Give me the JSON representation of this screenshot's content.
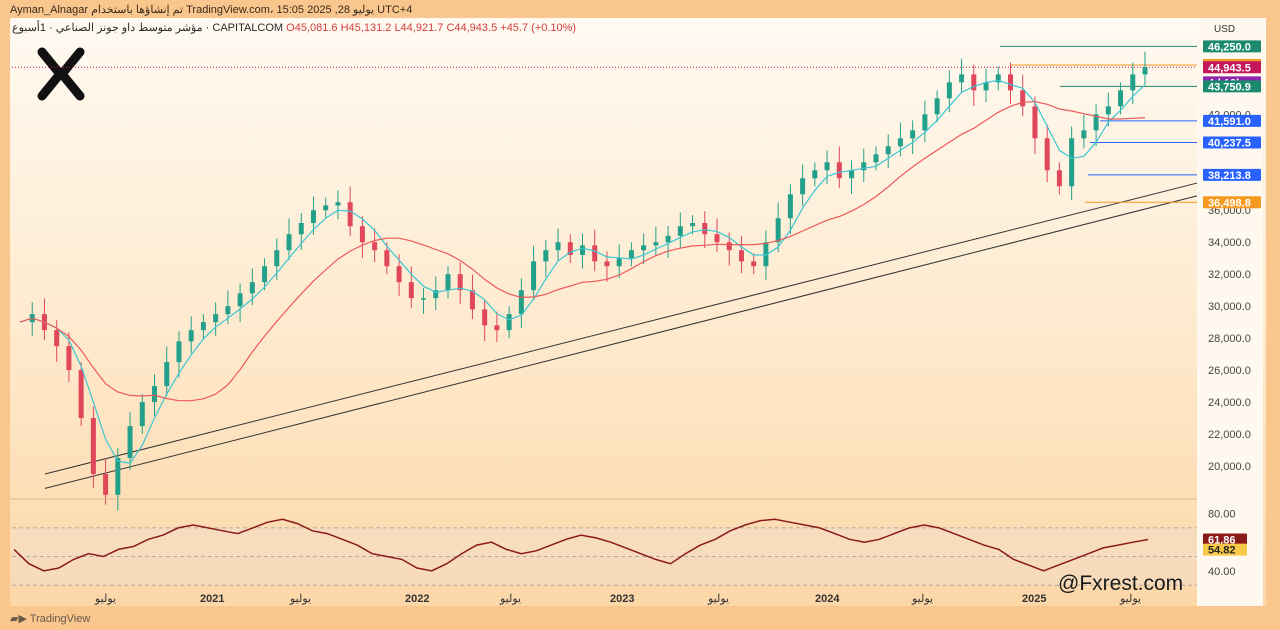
{
  "header": {
    "top_line": "Ayman_Alnagar تم إنشاؤها باستخدام TradingView.com، يوليو 28, 2025 15:05 UTC+4",
    "symbol_title": "مؤشر متوسط داو جونز الصناعي · 1أسبوع · CAPITALCOM",
    "o": "O45,081.6",
    "h": "H45,131.2",
    "l": "L44,921.7",
    "c": "C44,943.5",
    "chg": "+45.7 (+0.10%)"
  },
  "currency": "USD",
  "brand": "TradingView",
  "watermark": "@Fxrest.com",
  "colors": {
    "up": "#22a08a",
    "down": "#e0475a",
    "ma_fast": "#3cc6d2",
    "ma_slow": "#ec5a5a",
    "rsi": "#8a1a1a",
    "trend": "#333333"
  },
  "chart_data": [
    {
      "type": "line",
      "title": "",
      "x_ticks": [
        "يوليو",
        "2021",
        "يوليو",
        "2022",
        "يوليو",
        "2023",
        "يوليو",
        "2024",
        "يوليو",
        "2025",
        "يوليو"
      ],
      "y_ticks": [
        "20,000.0",
        "22,000.0",
        "24,000.0",
        "26,000.0",
        "28,000.0",
        "30,000.0",
        "32,000.0",
        "34,000.0",
        "36,000.0",
        "42,000.0"
      ],
      "ylim": [
        18000,
        47400
      ],
      "series": [
        {
          "values": [
            29000,
            29500,
            28500,
            27500,
            26000,
            23000,
            19500,
            18200,
            20500,
            22500,
            24000,
            25000,
            26500,
            27800,
            28500,
            29000,
            29500,
            30000,
            30800,
            31500,
            32500,
            33500,
            34500,
            35200,
            36000,
            36300,
            36500,
            35000,
            34000,
            33500,
            32500,
            31500,
            30500,
            30500,
            31000,
            32000,
            31000,
            29800,
            28800,
            28500,
            29500,
            31000,
            32800,
            33500,
            34000,
            33200,
            33800,
            32800,
            32500,
            33000,
            33500,
            33800,
            34000,
            34400,
            35000,
            35200,
            34500,
            34000,
            33500,
            32800,
            32500,
            34000,
            35500,
            37000,
            38000,
            38500,
            39000,
            38000,
            38500,
            39000,
            39500,
            40000,
            40500,
            41000,
            42000,
            43000,
            44000,
            44500,
            43500,
            44000,
            44500,
            43500,
            42500,
            40500,
            38500,
            37500,
            40500,
            41000,
            42000,
            42500,
            43500,
            44500,
            44943.5
          ]
        }
      ],
      "annotations": [
        {
          "label": "46,250.0",
          "value": 46250,
          "color": "#1b8a6f"
        },
        {
          "label": "45,082.4",
          "value": 45082.4,
          "color": "#f59a1f"
        },
        {
          "label": "44,943.5",
          "value": 44943.5,
          "color": "#c2185b"
        },
        {
          "label": "4d 10h",
          "value": 44000,
          "color": "#8e24aa"
        },
        {
          "label": "43,750.9",
          "value": 43750.9,
          "color": "#1b8a6f"
        },
        {
          "label": "41,591.0",
          "value": 41591,
          "color": "#2962ff"
        },
        {
          "label": "40,237.5",
          "value": 40237.5,
          "color": "#2962ff"
        },
        {
          "label": "38,213.8",
          "value": 38213.8,
          "color": "#2962ff"
        },
        {
          "label": "36,498.8",
          "value": 36498.8,
          "color": "#f59a1f"
        }
      ]
    },
    {
      "type": "line",
      "title": "",
      "y_ticks": [
        "80.00",
        "40.00"
      ],
      "ylim": [
        28,
        86
      ],
      "series": [
        {
          "values": [
            55,
            45,
            40,
            42,
            48,
            52,
            50,
            55,
            57,
            62,
            65,
            70,
            72,
            70,
            68,
            66,
            70,
            74,
            76,
            73,
            68,
            66,
            62,
            58,
            52,
            50,
            48,
            42,
            40,
            45,
            52,
            58,
            60,
            55,
            52,
            54,
            58,
            62,
            65,
            63,
            60,
            56,
            52,
            48,
            45,
            52,
            58,
            62,
            68,
            72,
            75,
            76,
            74,
            72,
            70,
            66,
            62,
            60,
            62,
            66,
            70,
            72,
            70,
            66,
            62,
            58,
            55,
            48,
            44,
            40,
            44,
            48,
            52,
            56,
            58,
            60,
            61.86
          ]
        },
        {
          "values": [
            54.82
          ]
        }
      ],
      "annotations": [
        {
          "label": "61.86",
          "value": 61.86,
          "color": "#8a1a1a"
        },
        {
          "label": "54.82",
          "value": 54.82,
          "color": "#f7c948"
        }
      ]
    }
  ]
}
